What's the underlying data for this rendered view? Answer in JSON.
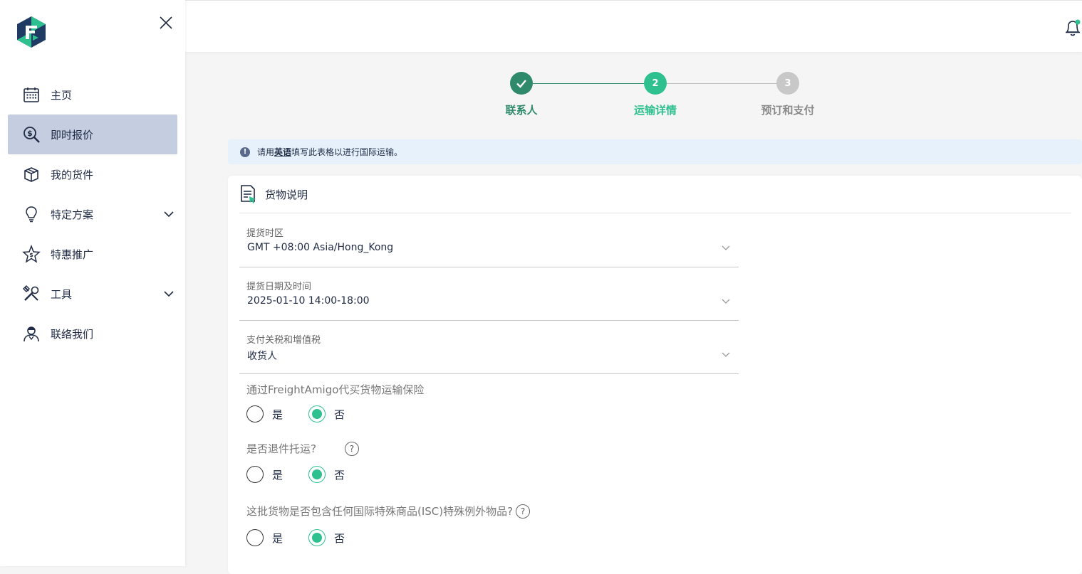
{
  "sidebar": {
    "items": [
      {
        "label": "主页",
        "icon": "calendar-icon"
      },
      {
        "label": "即时报价",
        "icon": "quote-search-icon",
        "active": true
      },
      {
        "label": "我的货件",
        "icon": "package-icon"
      },
      {
        "label": "特定方案",
        "icon": "lightbulb-icon",
        "expandable": true
      },
      {
        "label": "特惠推广",
        "icon": "promo-star-icon"
      },
      {
        "label": "工具",
        "icon": "tools-icon",
        "expandable": true
      },
      {
        "label": "联络我们",
        "icon": "support-agent-icon"
      }
    ]
  },
  "stepper": {
    "steps": [
      {
        "number": "1",
        "label": "联系人",
        "state": "done"
      },
      {
        "number": "2",
        "label": "运输详情",
        "state": "current"
      },
      {
        "number": "3",
        "label": "预订和支付",
        "state": "pending"
      }
    ]
  },
  "banner": {
    "pre": "请用",
    "emphasis": "英语",
    "post": "填写此表格以进行国际运输。"
  },
  "card": {
    "title": "货物说明",
    "fields": [
      {
        "label": "提货时区",
        "value": "GMT +08:00 Asia/Hong_Kong"
      },
      {
        "label": "提货日期及时间",
        "value": "2025-01-10 14:00-18:00"
      },
      {
        "label": "支付关税和增值税",
        "value": "收货人"
      }
    ],
    "questions": [
      {
        "text": "通过FreightAmigo代买货物运输保险",
        "yes": "是",
        "no": "否",
        "selected": "no"
      },
      {
        "text": "是否退件托运?",
        "help": "?",
        "yes": "是",
        "no": "否",
        "selected": "no"
      },
      {
        "text": "这批货物是否包含任何国际特殊商品(ISC)特殊例外物品?",
        "help": "?",
        "yes": "是",
        "no": "否",
        "selected": "no"
      }
    ]
  },
  "colors": {
    "accent": "#2ec08f",
    "done": "#2e8a6a",
    "pending": "#c8c8c8",
    "active_nav": "#c5cde0",
    "navy": "#1f2a44"
  }
}
